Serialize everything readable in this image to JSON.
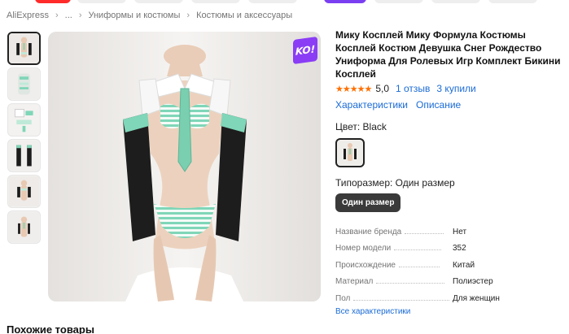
{
  "breadcrumb": [
    "AliExpress",
    "...",
    "Униформы и костюмы",
    "Костюмы и аксессуары"
  ],
  "product": {
    "title": "Мику Косплей Мику Формула Костюмы Косплей Костюм Девушка Снег Рождество Униформа Для Ролевых Игр Комплект Бикини Косплей",
    "stars": "★★★★★",
    "rating": "5,0",
    "reviews": "1 отзыв",
    "sold": "3 купили",
    "tabs": [
      "Характеристики",
      "Описание"
    ],
    "badge": "KO!",
    "color_label": "Цвет: Black",
    "size_label": "Типоразмер: Один размер",
    "size_option": "Один размер",
    "specs": [
      {
        "key": "Название бренда",
        "value": "Нет"
      },
      {
        "key": "Номер модели",
        "value": "352"
      },
      {
        "key": "Происхождение",
        "value": "Китай"
      },
      {
        "key": "Материал",
        "value": "Полиэстер"
      },
      {
        "key": "Пол",
        "value": "Для женщин"
      }
    ],
    "all_specs_link": "Все характеристики"
  },
  "similar_heading": "Похожие товары",
  "colors": {
    "link": "#1a6bd6",
    "star": "#ff6f00",
    "badge": "#8a3df5",
    "accent_teal": "#7fd6b8"
  }
}
